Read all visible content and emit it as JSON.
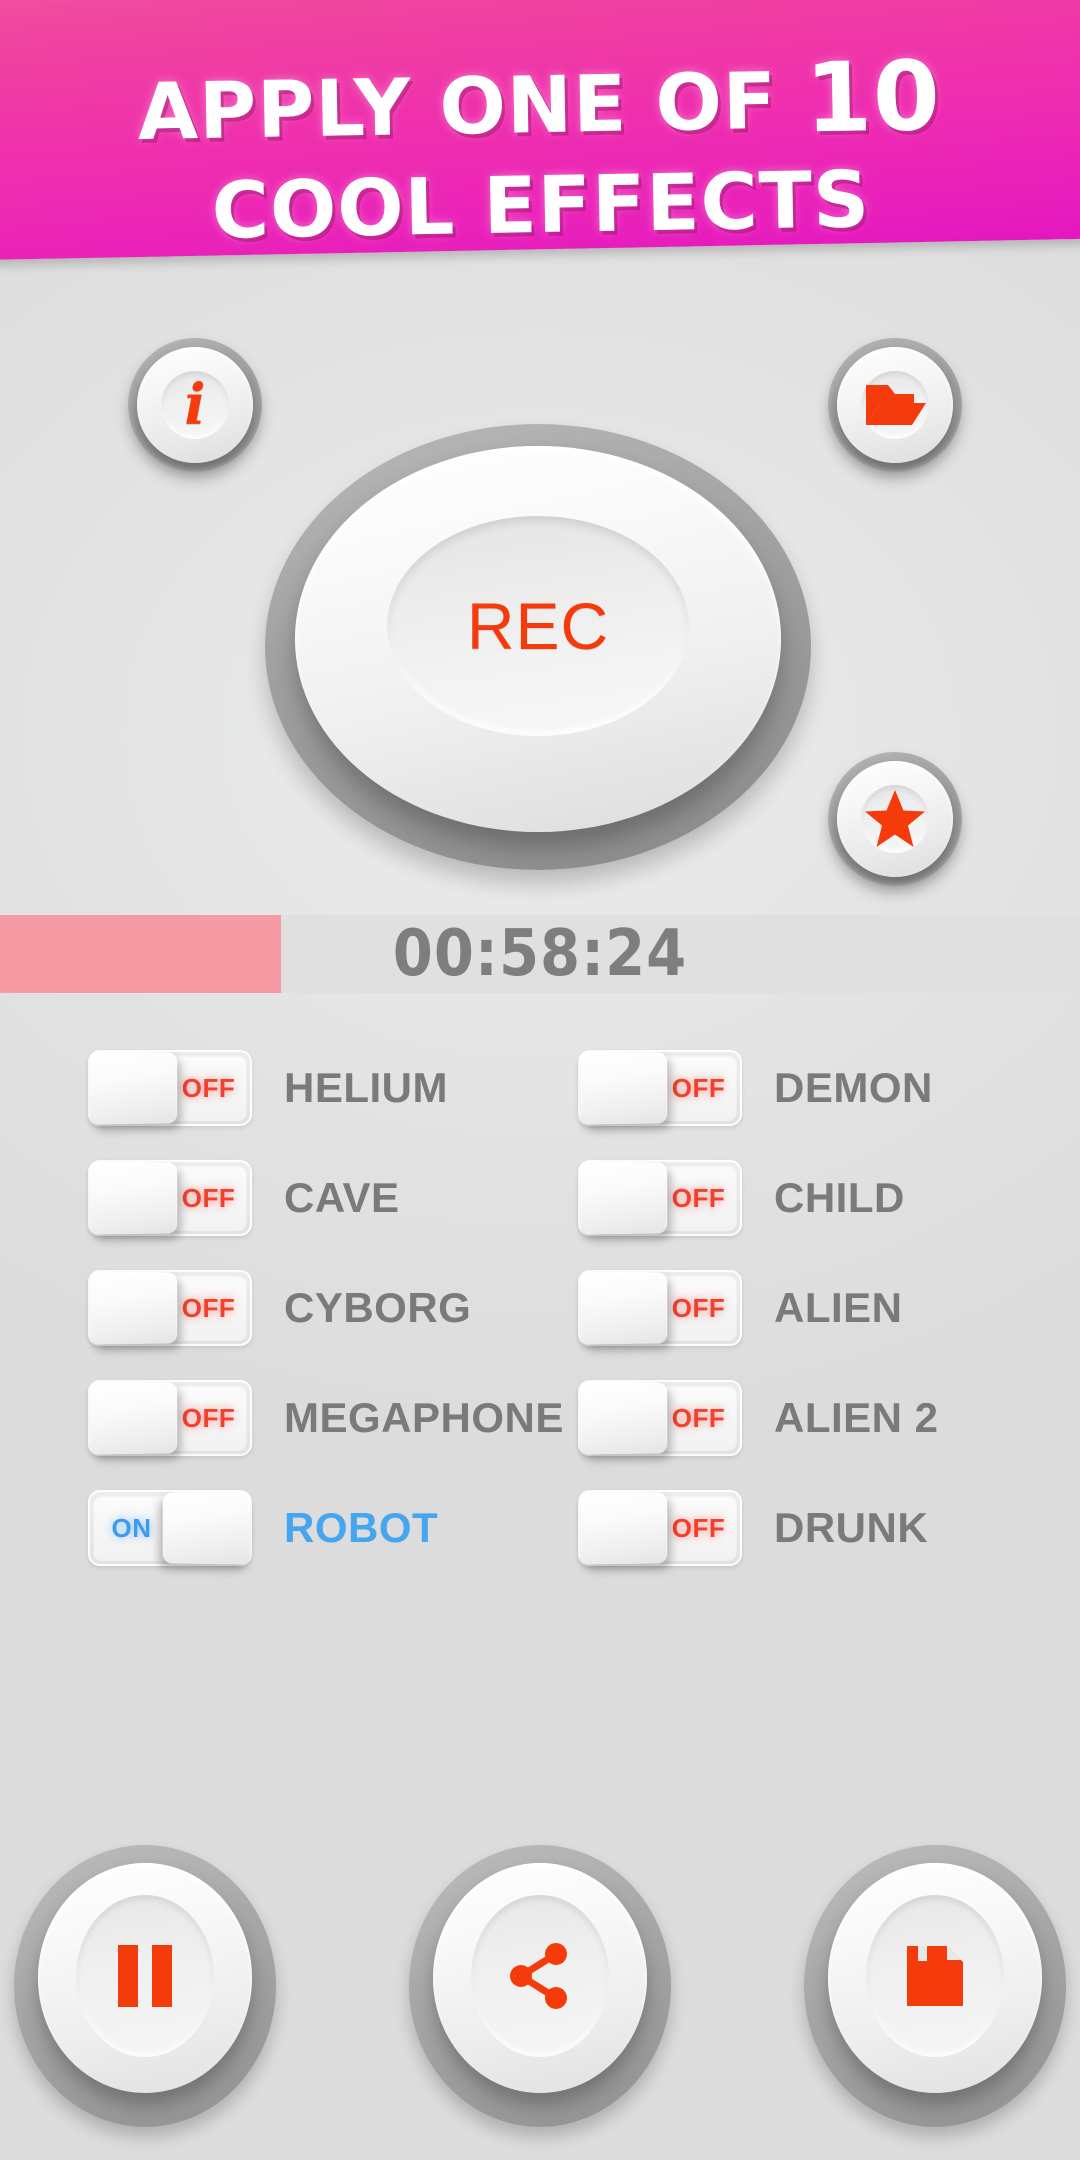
{
  "banner": {
    "line1_prefix": "APPLY ONE OF ",
    "line1_count": "10",
    "line2": "COOL EFFECTS",
    "bg_color_top": "#f058a1",
    "bg_color_bottom": "#e416c0",
    "text_color": "#ffffff"
  },
  "toolbar": {
    "info_label": "i",
    "info_icon": "info-icon",
    "folder_icon": "folder-open-icon",
    "star_icon": "star-icon",
    "accent_color": "#f53a0b"
  },
  "record": {
    "label": "REC",
    "label_color": "#f53a0b"
  },
  "playback": {
    "timer": "00:58:24",
    "timer_color": "#7e7e7e",
    "progress_percent": 26,
    "progress_color": "#f69ba4",
    "track_color": "#e0e0e0"
  },
  "effects": {
    "on_label": "ON",
    "off_label": "OFF",
    "on_color": "#3c9bf0",
    "off_color": "#f2402f",
    "label_color": "#7a7a7a",
    "active_label_color": "#45a6f0",
    "items": [
      {
        "name": "HELIUM",
        "state": "off"
      },
      {
        "name": "DEMON",
        "state": "off"
      },
      {
        "name": "CAVE",
        "state": "off"
      },
      {
        "name": "CHILD",
        "state": "off"
      },
      {
        "name": "CYBORG",
        "state": "off"
      },
      {
        "name": "ALIEN",
        "state": "off"
      },
      {
        "name": "MEGAPHONE",
        "state": "off"
      },
      {
        "name": "ALIEN 2",
        "state": "off"
      },
      {
        "name": "ROBOT",
        "state": "on"
      },
      {
        "name": "DRUNK",
        "state": "off"
      }
    ]
  },
  "transport": {
    "pause_icon": "pause-icon",
    "share_icon": "share-icon",
    "save_icon": "save-floppy-icon",
    "icon_color": "#f53a0b"
  }
}
